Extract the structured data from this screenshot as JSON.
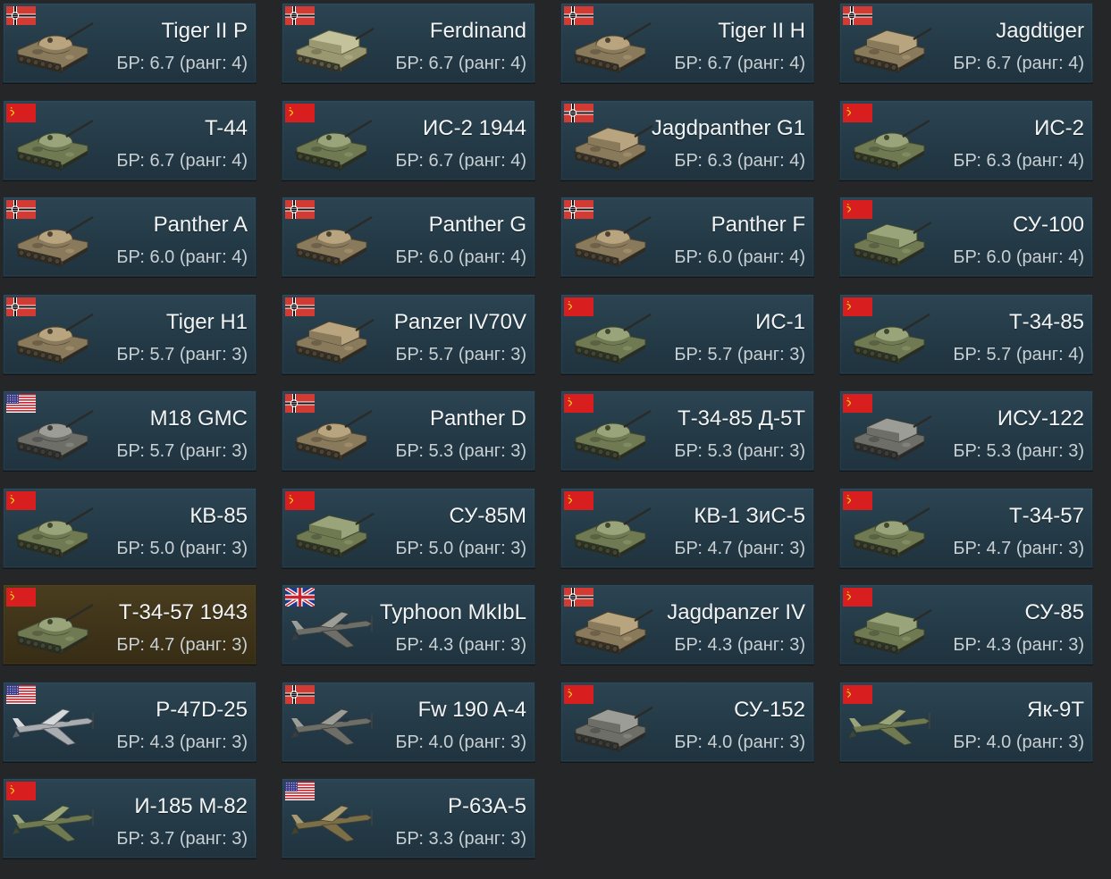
{
  "colors": {
    "background": "#252628",
    "card": "#2a4250",
    "card_selected": "#433820",
    "title_text": "#f2f4f5",
    "br_text": "#c8d0d4"
  },
  "vehicles": [
    {
      "name": "Tiger II P",
      "br": "БР: 6.7 (ранг: 4)",
      "nation": "germany",
      "kind": "tank",
      "camo": "tan",
      "flag_icon": "germany-flag-icon",
      "thumb_icon": "tank-icon"
    },
    {
      "name": "Ferdinand",
      "br": "БР: 6.7 (ранг: 4)",
      "nation": "germany",
      "kind": "td",
      "camo": "sand",
      "flag_icon": "germany-flag-icon",
      "thumb_icon": "tank-destroyer-icon"
    },
    {
      "name": "Tiger II H",
      "br": "БР: 6.7 (ранг: 4)",
      "nation": "germany",
      "kind": "tank",
      "camo": "tan",
      "flag_icon": "germany-flag-icon",
      "thumb_icon": "tank-icon"
    },
    {
      "name": "Jagdtiger",
      "br": "БР: 6.7 (ранг: 4)",
      "nation": "germany",
      "kind": "td",
      "camo": "tan",
      "flag_icon": "germany-flag-icon",
      "thumb_icon": "tank-destroyer-icon"
    },
    {
      "name": "T-44",
      "br": "БР: 6.7 (ранг: 4)",
      "nation": "ussr",
      "kind": "tank",
      "camo": "green",
      "flag_icon": "ussr-flag-icon",
      "thumb_icon": "tank-icon"
    },
    {
      "name": "ИС-2 1944",
      "br": "БР: 6.7 (ранг: 4)",
      "nation": "ussr",
      "kind": "tank",
      "camo": "green",
      "flag_icon": "ussr-flag-icon",
      "thumb_icon": "tank-icon"
    },
    {
      "name": "Jagdpanther G1",
      "br": "БР: 6.3 (ранг: 4)",
      "nation": "germany",
      "kind": "td",
      "camo": "tan",
      "flag_icon": "germany-flag-icon",
      "thumb_icon": "tank-destroyer-icon"
    },
    {
      "name": "ИС-2",
      "br": "БР: 6.3 (ранг: 4)",
      "nation": "ussr",
      "kind": "tank",
      "camo": "green",
      "flag_icon": "ussr-flag-icon",
      "thumb_icon": "tank-icon"
    },
    {
      "name": "Panther A",
      "br": "БР: 6.0 (ранг: 4)",
      "nation": "germany",
      "kind": "tank",
      "camo": "tan",
      "flag_icon": "germany-flag-icon",
      "thumb_icon": "tank-icon"
    },
    {
      "name": "Panther G",
      "br": "БР: 6.0 (ранг: 4)",
      "nation": "germany",
      "kind": "tank",
      "camo": "tan",
      "flag_icon": "germany-flag-icon",
      "thumb_icon": "tank-icon"
    },
    {
      "name": "Panther F",
      "br": "БР: 6.0 (ранг: 4)",
      "nation": "germany",
      "kind": "tank",
      "camo": "tan",
      "flag_icon": "germany-flag-icon",
      "thumb_icon": "tank-icon"
    },
    {
      "name": "СУ-100",
      "br": "БР: 6.0 (ранг: 4)",
      "nation": "ussr",
      "kind": "td",
      "camo": "green",
      "flag_icon": "ussr-flag-icon",
      "thumb_icon": "tank-destroyer-icon"
    },
    {
      "name": "Tiger H1",
      "br": "БР: 5.7 (ранг: 3)",
      "nation": "germany",
      "kind": "tank",
      "camo": "tan",
      "flag_icon": "germany-flag-icon",
      "thumb_icon": "tank-icon"
    },
    {
      "name": "Panzer IV70V",
      "br": "БР: 5.7 (ранг: 3)",
      "nation": "germany",
      "kind": "td",
      "camo": "tan",
      "flag_icon": "germany-flag-icon",
      "thumb_icon": "tank-destroyer-icon"
    },
    {
      "name": "ИС-1",
      "br": "БР: 5.7 (ранг: 3)",
      "nation": "ussr",
      "kind": "tank",
      "camo": "green",
      "flag_icon": "ussr-flag-icon",
      "thumb_icon": "tank-icon"
    },
    {
      "name": "Т-34-85",
      "br": "БР: 5.7 (ранг: 4)",
      "nation": "ussr",
      "kind": "tank",
      "camo": "green",
      "flag_icon": "ussr-flag-icon",
      "thumb_icon": "tank-icon"
    },
    {
      "name": "M18 GMC",
      "br": "БР: 5.7 (ранг: 3)",
      "nation": "usa",
      "kind": "tank",
      "camo": "grey",
      "flag_icon": "usa-flag-icon",
      "thumb_icon": "tank-destroyer-icon"
    },
    {
      "name": "Panther D",
      "br": "БР: 5.3 (ранг: 3)",
      "nation": "germany",
      "kind": "tank",
      "camo": "tan",
      "flag_icon": "germany-flag-icon",
      "thumb_icon": "tank-icon"
    },
    {
      "name": "Т-34-85 Д-5Т",
      "br": "БР: 5.3 (ранг: 3)",
      "nation": "ussr",
      "kind": "tank",
      "camo": "green",
      "flag_icon": "ussr-flag-icon",
      "thumb_icon": "tank-icon"
    },
    {
      "name": "ИСУ-122",
      "br": "БР: 5.3 (ранг: 3)",
      "nation": "ussr",
      "kind": "td",
      "camo": "grey",
      "flag_icon": "ussr-flag-icon",
      "thumb_icon": "tank-destroyer-icon"
    },
    {
      "name": "КВ-85",
      "br": "БР: 5.0 (ранг: 3)",
      "nation": "ussr",
      "kind": "tank",
      "camo": "green",
      "flag_icon": "ussr-flag-icon",
      "thumb_icon": "tank-icon"
    },
    {
      "name": "СУ-85М",
      "br": "БР: 5.0 (ранг: 3)",
      "nation": "ussr",
      "kind": "td",
      "camo": "green",
      "flag_icon": "ussr-flag-icon",
      "thumb_icon": "tank-destroyer-icon"
    },
    {
      "name": "КВ-1 ЗиС-5",
      "br": "БР: 4.7 (ранг: 3)",
      "nation": "ussr",
      "kind": "tank",
      "camo": "green",
      "flag_icon": "ussr-flag-icon",
      "thumb_icon": "tank-icon"
    },
    {
      "name": "Т-34-57",
      "br": "БР: 4.7 (ранг: 3)",
      "nation": "ussr",
      "kind": "tank",
      "camo": "green",
      "flag_icon": "ussr-flag-icon",
      "thumb_icon": "tank-icon"
    },
    {
      "name": "Т-34-57 1943",
      "br": "БР: 4.7 (ранг: 3)",
      "nation": "ussr",
      "kind": "tank",
      "camo": "green",
      "flag_icon": "ussr-flag-icon",
      "thumb_icon": "tank-icon",
      "selected": true
    },
    {
      "name": "Typhoon MkIbL",
      "br": "БР: 4.3 (ранг: 3)",
      "nation": "uk",
      "kind": "plane",
      "camo": "grey",
      "flag_icon": "uk-flag-icon",
      "thumb_icon": "airplane-icon"
    },
    {
      "name": "Jagdpanzer IV",
      "br": "БР: 4.3 (ранг: 3)",
      "nation": "germany",
      "kind": "td",
      "camo": "tan",
      "flag_icon": "germany-flag-icon",
      "thumb_icon": "tank-destroyer-icon"
    },
    {
      "name": "СУ-85",
      "br": "БР: 4.3 (ранг: 3)",
      "nation": "ussr",
      "kind": "td",
      "camo": "green",
      "flag_icon": "ussr-flag-icon",
      "thumb_icon": "tank-destroyer-icon"
    },
    {
      "name": "P-47D-25",
      "br": "БР: 4.3 (ранг: 3)",
      "nation": "usa",
      "kind": "plane",
      "camo": "silver",
      "flag_icon": "usa-flag-icon",
      "thumb_icon": "airplane-icon"
    },
    {
      "name": "Fw 190 A-4",
      "br": "БР: 4.0 (ранг: 3)",
      "nation": "germany",
      "kind": "plane",
      "camo": "grey",
      "flag_icon": "germany-flag-icon",
      "thumb_icon": "airplane-icon"
    },
    {
      "name": "СУ-152",
      "br": "БР: 4.0 (ранг: 3)",
      "nation": "ussr",
      "kind": "td",
      "camo": "grey",
      "flag_icon": "ussr-flag-icon",
      "thumb_icon": "tank-destroyer-icon"
    },
    {
      "name": "Як-9Т",
      "br": "БР: 4.0 (ранг: 3)",
      "nation": "ussr",
      "kind": "plane",
      "camo": "green",
      "flag_icon": "ussr-flag-icon",
      "thumb_icon": "airplane-icon"
    },
    {
      "name": "И-185 М-82",
      "br": "БР: 3.7 (ранг: 3)",
      "nation": "ussr",
      "kind": "plane",
      "camo": "green",
      "flag_icon": "ussr-flag-icon",
      "thumb_icon": "airplane-icon"
    },
    {
      "name": "P-63A-5",
      "br": "БР: 3.3 (ранг: 3)",
      "nation": "usa",
      "kind": "plane",
      "camo": "olive",
      "flag_icon": "usa-flag-icon",
      "thumb_icon": "airplane-icon"
    }
  ]
}
